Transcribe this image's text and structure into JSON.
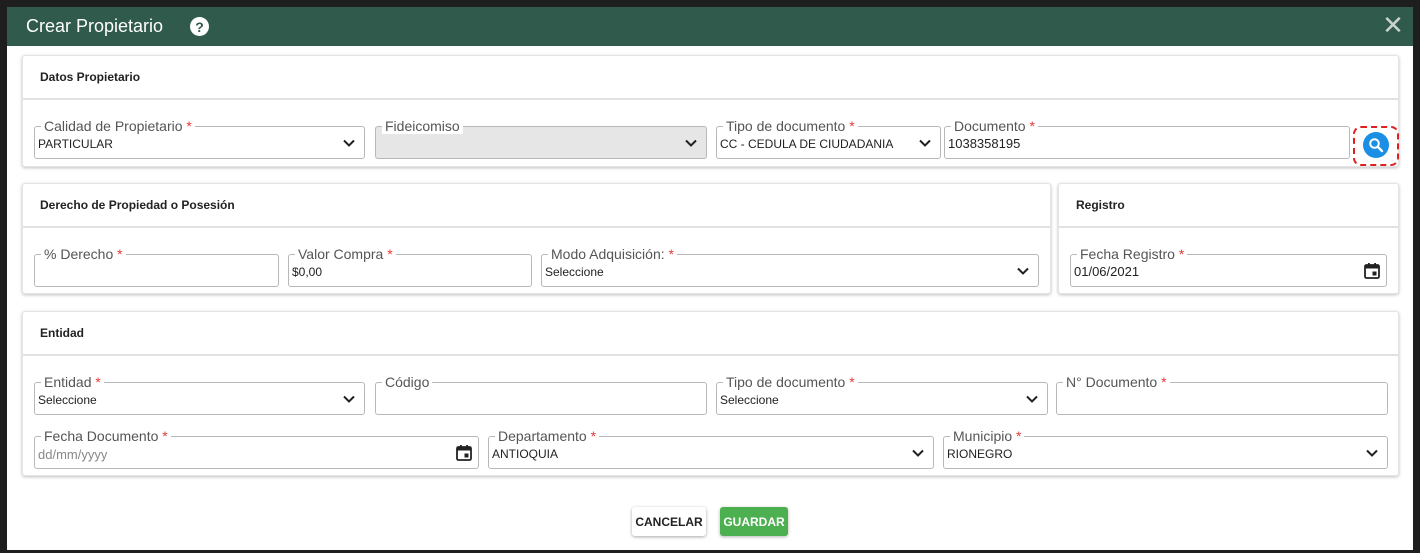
{
  "modal": {
    "title": "Crear Propietario",
    "help_icon": "question-circle-icon",
    "close_icon": "close-icon"
  },
  "owner_section": {
    "title": "Datos Propietario",
    "calidad": {
      "label": "Calidad de Propietario",
      "value": "PARTICULAR"
    },
    "fideicomiso": {
      "label": "Fideicomiso",
      "value": ""
    },
    "tipo_documento": {
      "label": "Tipo de documento",
      "value": "CC - CEDULA DE CIUDADANIA"
    },
    "documento": {
      "label": "Documento",
      "value": "1038358195"
    },
    "search_icon": "search-icon"
  },
  "rights_section": {
    "title": "Derecho de Propiedad o Posesión",
    "derecho": {
      "label": "% Derecho",
      "value": ""
    },
    "valor_compra": {
      "label": "Valor Compra",
      "value": "$0,00"
    },
    "modo_adquisicion": {
      "label": "Modo Adquisición:",
      "value": "Seleccione"
    }
  },
  "registro_section": {
    "title": "Registro",
    "fecha_registro": {
      "label": "Fecha Registro",
      "value": "01/06/2021"
    }
  },
  "entity_section": {
    "title": "Entidad",
    "entidad": {
      "label": "Entidad",
      "value": "Seleccione"
    },
    "codigo": {
      "label": "Código",
      "value": ""
    },
    "tipo_documento": {
      "label": "Tipo de documento",
      "value": "Seleccione"
    },
    "numero_documento": {
      "label": "N° Documento",
      "value": ""
    },
    "fecha_documento": {
      "label": "Fecha Documento",
      "placeholder": "dd/mm/yyyy"
    },
    "departamento": {
      "label": "Departamento",
      "value": "ANTIOQUIA"
    },
    "municipio": {
      "label": "Municipio",
      "value": "RIONEGRO"
    }
  },
  "actions": {
    "cancel_label": "CANCELAR",
    "save_label": "GUARDAR"
  },
  "required_mark": "*",
  "colors": {
    "header": "#2f5a4c",
    "required": "#e53935",
    "save": "#4caf50",
    "search": "#1a8fe3",
    "highlight": "#e02020"
  }
}
